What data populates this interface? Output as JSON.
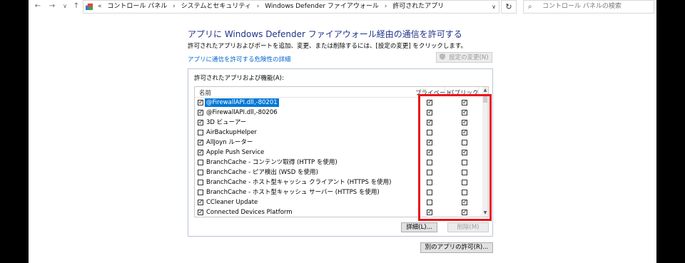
{
  "nav": {
    "back": "←",
    "forward": "→",
    "recent": "∨",
    "up": "↑"
  },
  "address": {
    "crumbs": [
      "コントロール パネル",
      "システムとセキュリティ",
      "Windows Defender ファイアウォール",
      "許可されたアプリ"
    ],
    "first_sep": "«",
    "sep": "›",
    "dropdown": "∨",
    "refresh": "↻"
  },
  "search": {
    "icon": "⌕",
    "placeholder": "コントロール パネルの検索"
  },
  "heading": "アプリに Windows Defender ファイアウォール経由の通信を許可する",
  "instructions": "許可されたアプリおよびポートを追加、変更、または削除するには、[設定の変更] をクリックします。",
  "risk_link": "アプリに通信を許可する危険性の詳細",
  "change_settings": "設定の変更(N)",
  "change_settings_icon": "shield-icon",
  "group_title": "許可されたアプリおよび機能(A):",
  "columns": {
    "name": "名前",
    "private": "プライベート",
    "public": "パブリック"
  },
  "rows": [
    {
      "name": "@FirewallAPI.dll,-80201",
      "enabled": true,
      "private": true,
      "public": true,
      "selected": true
    },
    {
      "name": "@FirewallAPI.dll,-80206",
      "enabled": true,
      "private": true,
      "public": true
    },
    {
      "name": "3D ビューアー",
      "enabled": true,
      "private": true,
      "public": true
    },
    {
      "name": "AirBackupHelper",
      "enabled": false,
      "private": false,
      "public": true
    },
    {
      "name": "AllJoyn ルーター",
      "enabled": true,
      "private": true,
      "public": false
    },
    {
      "name": "Apple Push Service",
      "enabled": true,
      "private": true,
      "public": true
    },
    {
      "name": "BranchCache - コンテンツ取得 (HTTP を使用)",
      "enabled": false,
      "private": false,
      "public": false
    },
    {
      "name": "BranchCache - ピア検出 (WSD を使用)",
      "enabled": false,
      "private": false,
      "public": false
    },
    {
      "name": "BranchCache - ホスト型キャッシュ クライアント (HTTPS を使用)",
      "enabled": false,
      "private": false,
      "public": false
    },
    {
      "name": "BranchCache - ホスト型キャッシュ サーバー (HTTPS を使用)",
      "enabled": false,
      "private": false,
      "public": false
    },
    {
      "name": "CCleaner Update",
      "enabled": true,
      "private": false,
      "public": true
    },
    {
      "name": "Connected Devices Platform",
      "enabled": true,
      "private": true,
      "public": true
    }
  ],
  "scroll": {
    "up": "▲",
    "down": "▼"
  },
  "details_button": "詳細(L)...",
  "remove_button": "削除(M)",
  "allow_other_button": "別のアプリの許可(R)...",
  "check_glyph": "✓",
  "colors": {
    "highlight": "#e8151b",
    "selected_row": "#0078d7",
    "heading": "#1e3287",
    "link": "#0066cc"
  }
}
